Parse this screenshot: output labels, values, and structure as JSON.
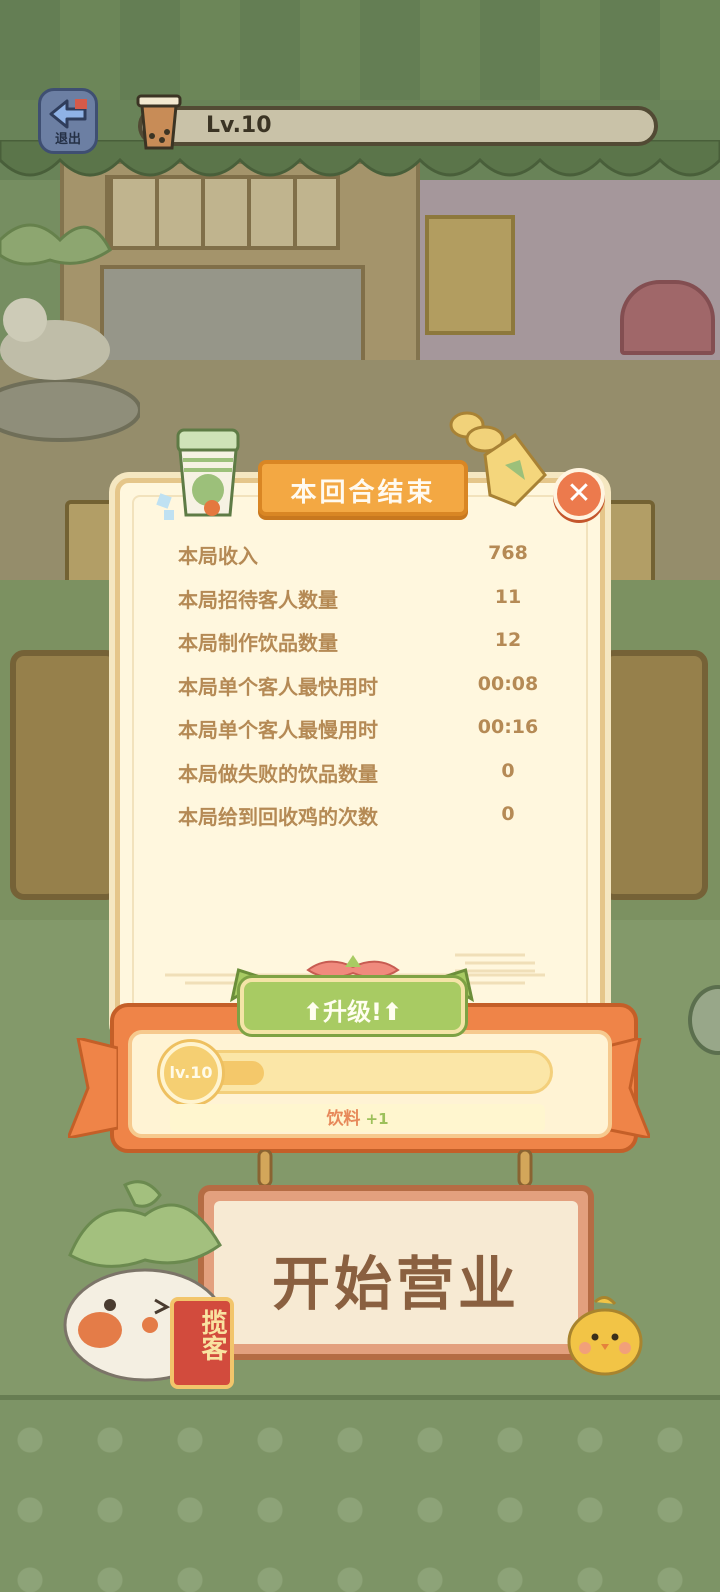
{
  "top_bar": {
    "exit_label": "退出",
    "level": "Lv.10"
  },
  "dialog": {
    "title": "本回合结束",
    "stats": [
      {
        "label": "本局收入",
        "value": "768"
      },
      {
        "label": "本局招待客人数量",
        "value": "11"
      },
      {
        "label": "本局制作饮品数量",
        "value": "12"
      },
      {
        "label": "本局单个客人最快用时",
        "value": "00:08"
      },
      {
        "label": "本局单个客人最慢用时",
        "value": "00:16"
      },
      {
        "label": "本局做失败的饮品数量",
        "value": "0"
      },
      {
        "label": "本局给到回收鸡的次数",
        "value": "0"
      }
    ]
  },
  "upgrade": {
    "title": "升级!",
    "level_badge": "lv.10",
    "progress": 0.25,
    "reward_label": "饮料",
    "reward_value": "+1"
  },
  "actions": {
    "start_label": "开始营业",
    "promo_label": "揽客"
  },
  "colors": {
    "accent_orange": "#f3a843",
    "text_brown": "#b58a55",
    "upgrade_green": "#a8cb63",
    "close_red": "#ec7a4d"
  },
  "icons": {
    "exit": "back-arrow-icon",
    "close": "close-icon",
    "level": "milk-tea-cup-icon"
  }
}
